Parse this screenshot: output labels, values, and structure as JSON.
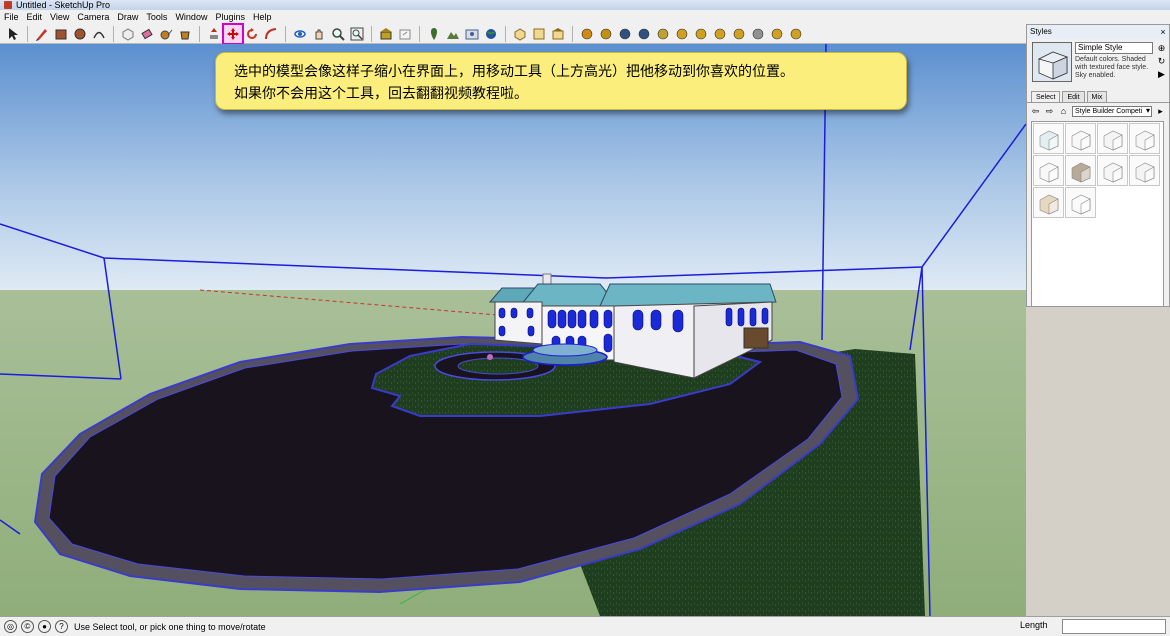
{
  "window": {
    "title": "Untitled - SketchUp Pro"
  },
  "menu": [
    "File",
    "Edit",
    "View",
    "Camera",
    "Draw",
    "Tools",
    "Window",
    "Plugins",
    "Help"
  ],
  "toolbar": {
    "tools": [
      {
        "name": "select-tool",
        "icon": "arrow-icon",
        "color": "#222222"
      },
      {
        "sep": true
      },
      {
        "name": "line-tool",
        "icon": "pencil-icon",
        "color": "#c0392b"
      },
      {
        "name": "rectangle-tool",
        "icon": "rectangle-icon",
        "color": "#a0522d"
      },
      {
        "name": "circle-tool",
        "icon": "circle-icon",
        "color": "#a0522d"
      },
      {
        "name": "arc-tool",
        "icon": "arc-icon",
        "color": "#333333"
      },
      {
        "sep": true
      },
      {
        "name": "make-component-tool",
        "icon": "component-icon",
        "color": "#777777"
      },
      {
        "name": "eraser-tool",
        "icon": "eraser-icon",
        "color": "#e06fa0"
      },
      {
        "name": "tape-measure-tool",
        "icon": "tape-icon",
        "color": "#444444"
      },
      {
        "name": "paint-bucket-tool",
        "icon": "bucket-icon",
        "color": "#c08020"
      },
      {
        "sep": true
      },
      {
        "name": "push-pull-tool",
        "icon": "pushpull-icon",
        "color": "#b03020"
      },
      {
        "name": "move-tool",
        "icon": "move-icon",
        "color": "#d40000",
        "active": true
      },
      {
        "name": "rotate-tool",
        "icon": "rotate-icon",
        "color": "#d03020"
      },
      {
        "name": "follow-me-tool",
        "icon": "followme-icon",
        "color": "#c03020"
      },
      {
        "sep": true
      },
      {
        "name": "orbit-tool",
        "icon": "orbit-icon",
        "color": "#2060c0"
      },
      {
        "name": "pan-tool",
        "icon": "pan-icon",
        "color": "#444444"
      },
      {
        "name": "zoom-tool",
        "icon": "zoom-icon",
        "color": "#444444"
      },
      {
        "name": "zoom-extents-tool",
        "icon": "zoom-extents-icon",
        "color": "#444444"
      },
      {
        "sep": true
      },
      {
        "name": "get-models-tool",
        "icon": "warehouse-icon",
        "color": "#c0a020"
      },
      {
        "name": "share-model-tool",
        "icon": "share-icon",
        "color": "#888888"
      },
      {
        "sep": true
      },
      {
        "name": "add-location-tool",
        "icon": "location-icon",
        "color": "#3a6e2a"
      },
      {
        "name": "toggle-terrain-tool",
        "icon": "terrain-icon",
        "color": "#5a7a3a"
      },
      {
        "name": "photo-texture-tool",
        "icon": "photo-icon",
        "color": "#4060a0"
      },
      {
        "name": "google-earth-tool",
        "icon": "earth-icon",
        "color": "#2050a0"
      },
      {
        "sep": true
      },
      {
        "name": "iso-view-tool",
        "icon": "iso-icon",
        "color": "#8a6a20"
      },
      {
        "name": "top-view-tool",
        "icon": "top-view-icon",
        "color": "#8a6a20"
      },
      {
        "name": "front-view-tool",
        "icon": "front-view-icon",
        "color": "#8a6a20"
      },
      {
        "sep": true
      },
      {
        "name": "plugin-a-tool",
        "icon": "plugin-icon",
        "color": "#d08a10"
      },
      {
        "name": "plugin-b-tool",
        "icon": "plugin-icon",
        "color": "#c09010"
      },
      {
        "name": "plugin-c-tool",
        "icon": "plugin-icon",
        "color": "#305080"
      },
      {
        "name": "plugin-d-tool",
        "icon": "plugin-icon",
        "color": "#305080"
      },
      {
        "name": "plugin-e-tool",
        "icon": "plugin-icon",
        "color": "#c0a030"
      },
      {
        "name": "plugin-f-tool",
        "icon": "plugin-icon",
        "color": "#d0a020"
      },
      {
        "name": "plugin-g-tool",
        "icon": "plugin-icon",
        "color": "#d0a020"
      },
      {
        "name": "plugin-h-tool",
        "icon": "plugin-icon",
        "color": "#d0a020"
      },
      {
        "name": "plugin-i-tool",
        "icon": "plugin-icon",
        "color": "#d0a020"
      },
      {
        "name": "plugin-j-tool",
        "icon": "plugin-icon",
        "color": "#909090"
      },
      {
        "name": "plugin-k-tool",
        "icon": "plugin-icon",
        "color": "#d0a020"
      },
      {
        "name": "plugin-l-tool",
        "icon": "plugin-icon",
        "color": "#d0a020"
      }
    ]
  },
  "tooltip": {
    "line1": "选中的模型会像这样子缩小在界面上，用移动工具（上方高光）把他移动到你喜欢的位置。",
    "line2": "如果你不会用这个工具，回去翻翻视频教程啦。"
  },
  "styles_panel": {
    "title": "Styles",
    "close": "×",
    "style_name": "Simple Style",
    "style_desc": "Default colors.  Shaded with textured face style.  Sky enabled.",
    "tabs": [
      "Select",
      "Edit",
      "Mix"
    ],
    "active_tab": "Select",
    "collection": "Style Builder Competi"
  },
  "statusbar": {
    "message": "Use Select tool, or pick one thing to move/rotate",
    "help": "?",
    "length_label": "Length",
    "length_value": ""
  },
  "colors": {
    "sky_top": "#5b8fcf",
    "sky_bottom": "#d8e6f2",
    "ground": "#9cb58a",
    "lawn": "#1f3d1f",
    "driveway": "#18131c",
    "selection": "#1c1cdc",
    "tooltip_bg": "#fbee7c",
    "active_tool": "#d400c8"
  }
}
